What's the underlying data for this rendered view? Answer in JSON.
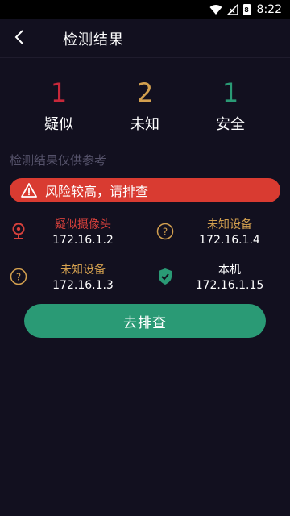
{
  "status_bar": {
    "time": "8:22",
    "battery_label": "8"
  },
  "header": {
    "title": "检测结果"
  },
  "summary": [
    {
      "count": "1",
      "label": "疑似",
      "color": "#c8283a"
    },
    {
      "count": "2",
      "label": "未知",
      "color": "#d3a04f"
    },
    {
      "count": "1",
      "label": "安全",
      "color": "#2a9a75"
    }
  ],
  "note": "检测结果仅供参考",
  "alert": {
    "text": "风险较高，请排查",
    "icon": "warning-triangle-icon",
    "color": "#d93b31"
  },
  "devices": [
    {
      "name": "疑似摄像头",
      "ip": "172.16.1.2",
      "icon": "webcam-icon",
      "color": "#d8413c"
    },
    {
      "name": "未知设备",
      "ip": "172.16.1.4",
      "icon": "question-icon",
      "color": "#d3a04f"
    },
    {
      "name": "未知设备",
      "ip": "172.16.1.3",
      "icon": "question-icon",
      "color": "#d3a04f"
    },
    {
      "name": "本机",
      "ip": "172.16.1.15",
      "icon": "shield-check-icon",
      "color": "#ffffff"
    }
  ],
  "cta": {
    "label": "去排查"
  },
  "colors": {
    "background": "#12101f",
    "accent": "#2a9a75"
  }
}
